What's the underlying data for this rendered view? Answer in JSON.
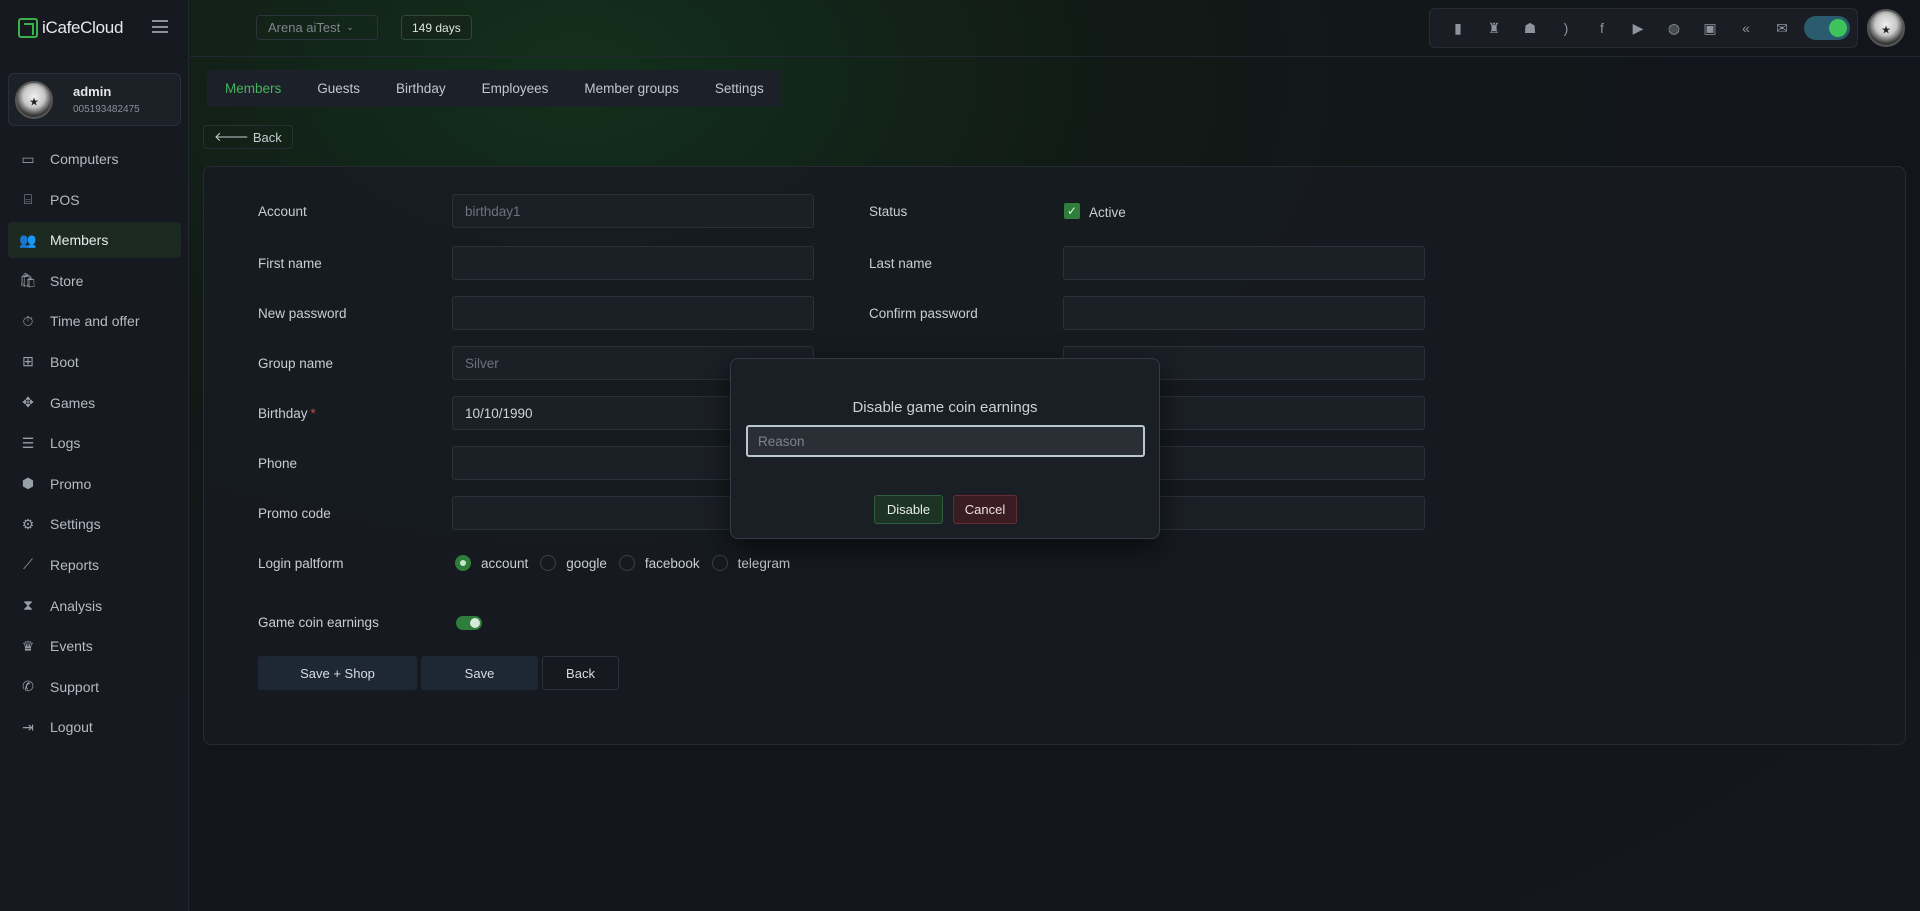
{
  "app": {
    "name": "iCafeCloud"
  },
  "user": {
    "name": "admin",
    "id": "005193482475"
  },
  "sidebar": {
    "items": [
      {
        "label": "Computers",
        "icon": "monitor-icon",
        "glyph": "▭"
      },
      {
        "label": "POS",
        "icon": "cash-register-icon",
        "glyph": "⌸"
      },
      {
        "label": "Members",
        "icon": "users-icon",
        "glyph": "👥",
        "active": true
      },
      {
        "label": "Store",
        "icon": "shopping-bag-icon",
        "glyph": "🛍"
      },
      {
        "label": "Time and offer",
        "icon": "stopwatch-icon",
        "glyph": "⏱"
      },
      {
        "label": "Boot",
        "icon": "windows-icon",
        "glyph": "⊞"
      },
      {
        "label": "Games",
        "icon": "gamepad-icon",
        "glyph": "✥"
      },
      {
        "label": "Logs",
        "icon": "list-icon",
        "glyph": "☰"
      },
      {
        "label": "Promo",
        "icon": "tag-icon",
        "glyph": "⬢"
      },
      {
        "label": "Settings",
        "icon": "gear-icon",
        "glyph": "⚙"
      },
      {
        "label": "Reports",
        "icon": "line-chart-icon",
        "glyph": "⟋"
      },
      {
        "label": "Analysis",
        "icon": "area-chart-icon",
        "glyph": "⧗"
      },
      {
        "label": "Events",
        "icon": "crown-icon",
        "glyph": "♛"
      },
      {
        "label": "Support",
        "icon": "phone-icon",
        "glyph": "✆"
      },
      {
        "label": "Logout",
        "icon": "logout-icon",
        "glyph": "⇥"
      }
    ]
  },
  "topbar": {
    "branch": "Arena aiTest",
    "days_left": "149 days",
    "tray_icons": [
      {
        "name": "ranking-icon",
        "glyph": "▮"
      },
      {
        "name": "trophy-icon",
        "glyph": "♜"
      },
      {
        "name": "group-icon",
        "glyph": "☗"
      },
      {
        "name": "rss-icon",
        "glyph": ")"
      },
      {
        "name": "facebook-icon",
        "glyph": "f"
      },
      {
        "name": "youtube-icon",
        "glyph": "▶"
      },
      {
        "name": "globe-icon",
        "glyph": "◍"
      },
      {
        "name": "icafe-icon",
        "glyph": "▣"
      },
      {
        "name": "double-chevron-icon",
        "glyph": "«"
      },
      {
        "name": "mail-icon",
        "glyph": "✉"
      }
    ]
  },
  "tabs": [
    "Members",
    "Guests",
    "Birthday",
    "Employees",
    "Member groups",
    "Settings"
  ],
  "back_label": "Back",
  "form": {
    "account_label": "Account",
    "account_value": "birthday1",
    "status_label": "Status",
    "status_value": "Active",
    "first_name_label": "First name",
    "last_name_label": "Last name",
    "new_password_label": "New password",
    "confirm_password_label": "Confirm password",
    "group_name_label": "Group name",
    "group_name_value": "Silver",
    "birthday_label": "Birthday",
    "birthday_required": "*",
    "birthday_value": "10/10/1990",
    "phone_label": "Phone",
    "promo_code_label": "Promo code",
    "login_platform_label": "Login paltform",
    "login_platforms": [
      "account",
      "google",
      "facebook",
      "telegram"
    ],
    "game_coin_label": "Game coin earnings",
    "game_coin_enabled": true,
    "buttons": {
      "save_shop": "Save + Shop",
      "save": "Save",
      "back": "Back"
    }
  },
  "modal": {
    "title": "Disable game coin earnings",
    "reason_placeholder": "Reason",
    "disable_label": "Disable",
    "cancel_label": "Cancel"
  }
}
